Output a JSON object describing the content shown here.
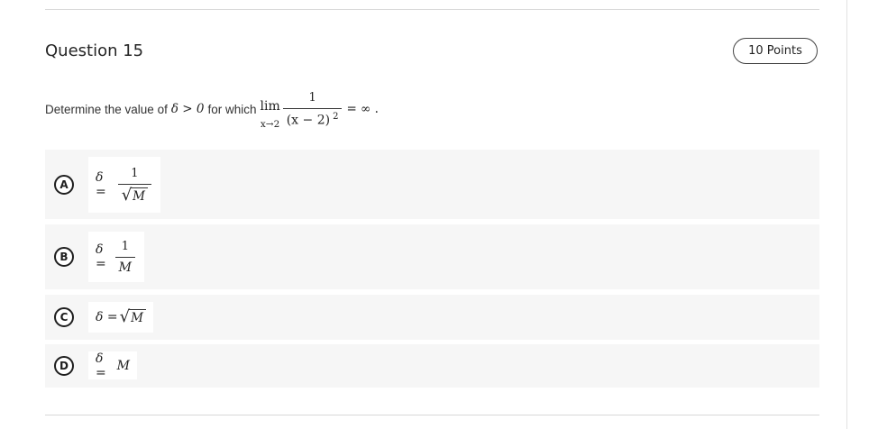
{
  "question": {
    "title": "Question 15",
    "points": "10 Points",
    "prompt_text": "Determine the value of",
    "prompt_condition": "δ > 0",
    "prompt_for_which": "for which",
    "limit": {
      "operator": "lim",
      "subscript": "x→2",
      "numerator": "1",
      "denominator": "(x − 2)",
      "exponent": "2",
      "result": "= ∞ ."
    }
  },
  "options": [
    {
      "letter": "A",
      "lhs": "δ =",
      "numerator": "1",
      "radical_sign": "√",
      "radicand": "M"
    },
    {
      "letter": "B",
      "lhs": "δ =",
      "numerator": "1",
      "denominator": "M"
    },
    {
      "letter": "C",
      "lhs": "δ =",
      "radical_sign": "√",
      "radicand": "M"
    },
    {
      "letter": "D",
      "lhs": "δ =",
      "rhs": "M"
    }
  ]
}
